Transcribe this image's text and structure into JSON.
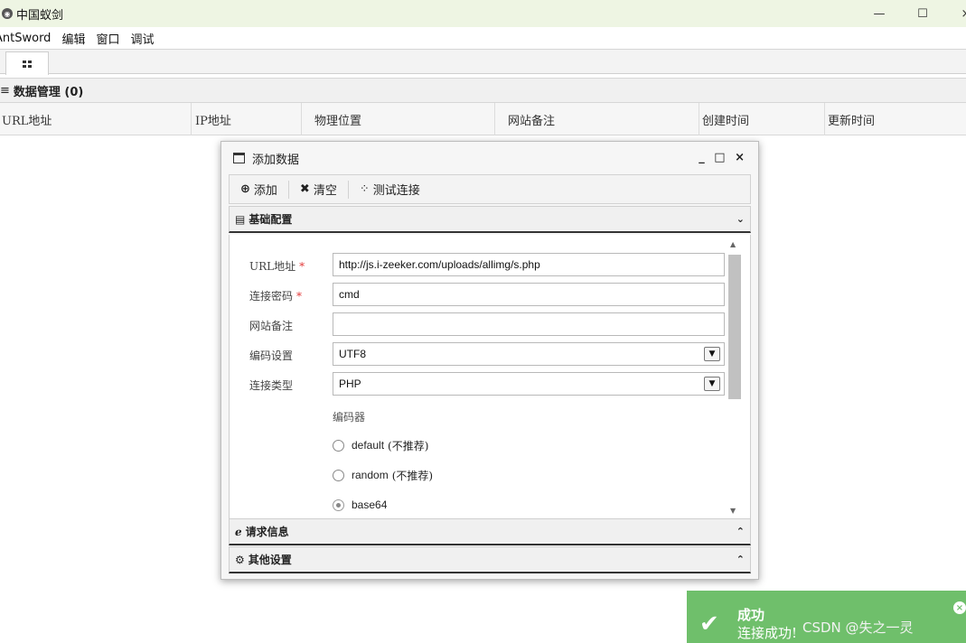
{
  "window": {
    "title": "中国蚁剑",
    "minimize_symbol": "—",
    "maximize_symbol": "☐",
    "close_symbol": "×"
  },
  "menu": [
    "AntSword",
    "编辑",
    "窗口",
    "调试"
  ],
  "tabs": [
    {
      "icon": "grid-icon"
    }
  ],
  "data_panel": {
    "title": "数据管理 (0)",
    "columns": [
      "URL地址",
      "IP地址",
      "物理位置",
      "网站备注",
      "创建时间",
      "更新时间"
    ]
  },
  "dialog": {
    "title": "添加数据",
    "controls": "_ □ ×",
    "toolbar": {
      "add": "添加",
      "clear": "清空",
      "test": "测试连接"
    },
    "sections": {
      "basic": "基础配置",
      "request": "请求信息",
      "other": "其他设置"
    },
    "form": {
      "url_label": "URL地址",
      "url_value": "http://js.i-zeeker.com/uploads/allimg/s.php",
      "password_label": "连接密码",
      "password_value": "cmd",
      "note_label": "网站备注",
      "note_value": "",
      "encoding_label": "编码设置",
      "encoding_value": "UTF8",
      "type_label": "连接类型",
      "type_value": "PHP",
      "required_mark": "*",
      "encoder_label": "编码器",
      "encoders": [
        {
          "name": "default",
          "note": "(不推荐)",
          "selected": false
        },
        {
          "name": "random",
          "note": "(不推荐)",
          "selected": false
        },
        {
          "name": "base64",
          "note": "",
          "selected": true
        }
      ]
    }
  },
  "toast": {
    "title": "成功",
    "message": "连接成功!",
    "watermark": "CSDN @失之一灵",
    "color": "#6fbf6b"
  }
}
